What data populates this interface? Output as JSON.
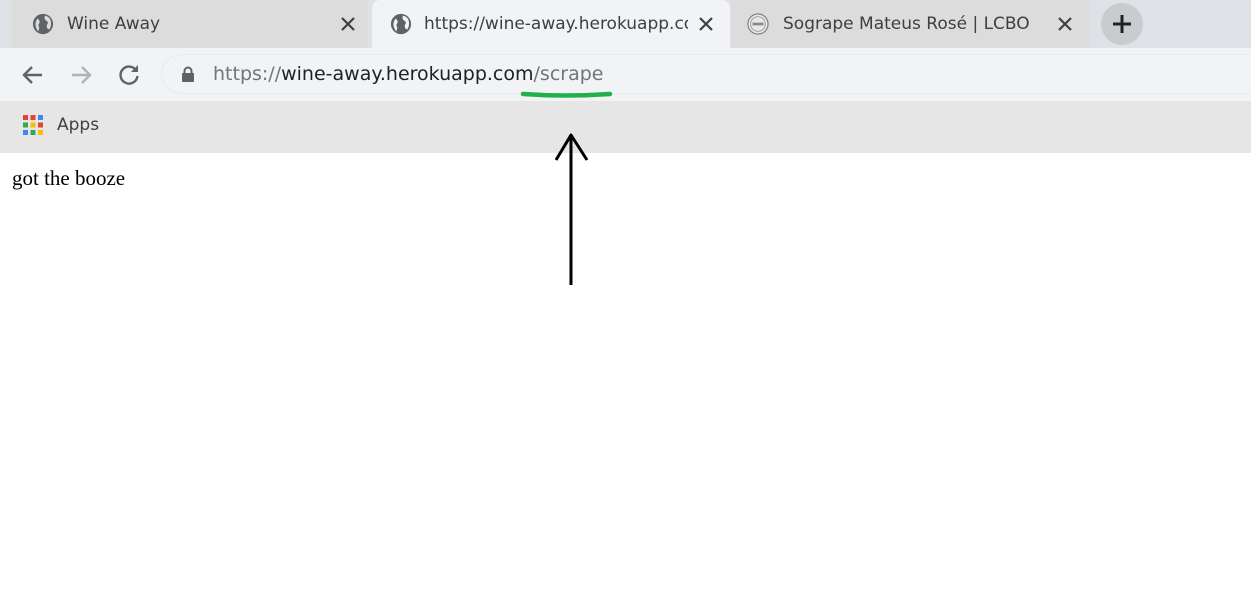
{
  "tabs": [
    {
      "title": "Wine Away",
      "active": false
    },
    {
      "title": "https://wine-away.herokuapp.com/scrape",
      "active": true
    },
    {
      "title": "Sogrape Mateus Rosé | LCBO",
      "active": false
    }
  ],
  "toolbar": {
    "url_scheme": "https://",
    "url_host": "wine-away.herokuapp.com",
    "url_path": "/scrape"
  },
  "bookmarks": {
    "apps_label": "Apps"
  },
  "page": {
    "body_text": "got the booze"
  },
  "colors": {
    "annotation_underline": "#22b04a",
    "annotation_arrow": "#000000"
  },
  "icons": {
    "favicon_1": "globe-icon",
    "favicon_2": "globe-icon",
    "favicon_3": "lcbo-logo-icon",
    "new_tab": "plus-icon",
    "back": "arrow-left-icon",
    "forward": "arrow-right-icon",
    "reload": "reload-icon",
    "secure": "lock-icon",
    "apps": "apps-grid-icon"
  }
}
